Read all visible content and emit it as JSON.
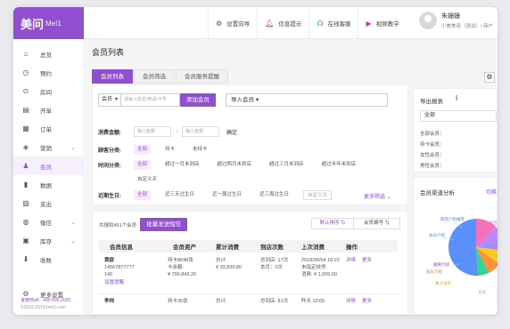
{
  "app": {
    "logo_text": "美问",
    "logo_sub": "MeI1",
    "brand_color": "#8f4fcf"
  },
  "top_nav": [
    {
      "label": "设置向导",
      "icon": "gear-icon",
      "color": "#555"
    },
    {
      "label": "信息提示",
      "icon": "bell-icon",
      "color": "#e0443a"
    },
    {
      "label": "在线客服",
      "icon": "headset-icon",
      "color": "#2ba7a0"
    },
    {
      "label": "视频教学",
      "icon": "play-icon",
      "color": "#c03ab7"
    }
  ],
  "user": {
    "name": "朱姗姗",
    "sub": "小美美容（测试）/ 商户"
  },
  "sidebar": {
    "items": [
      {
        "label": "总览",
        "icon": "home-icon",
        "glyph": "⌂"
      },
      {
        "label": "预约",
        "icon": "clock-icon",
        "glyph": "◷"
      },
      {
        "label": "房间",
        "icon": "bed-icon",
        "glyph": "⊙"
      },
      {
        "label": "开单",
        "icon": "receipt-icon",
        "glyph": "▤"
      },
      {
        "label": "订单",
        "icon": "order-icon",
        "glyph": "▦"
      },
      {
        "label": "营销",
        "icon": "basket-icon",
        "glyph": "◈",
        "chevron": true
      },
      {
        "label": "会员",
        "icon": "users-icon",
        "glyph": "♟",
        "active": true
      },
      {
        "label": "数据",
        "icon": "chart-icon",
        "glyph": "▮"
      },
      {
        "label": "支出",
        "icon": "expense-icon",
        "glyph": "▧"
      },
      {
        "label": "微信",
        "icon": "wechat-icon",
        "glyph": "◍",
        "chevron": true
      },
      {
        "label": "库存",
        "icon": "stock-icon",
        "glyph": "▣",
        "chevron": true
      },
      {
        "label": "收账",
        "icon": "download-icon",
        "glyph": "⬇"
      }
    ],
    "settings": {
      "label": "更多设置",
      "icon": "settings-icon",
      "glyph": "⚙"
    },
    "footer_service": "客服热线：400-006-2020",
    "footer_copyright": "©2015-2019,mei1.com"
  },
  "page": {
    "title": "会员列表",
    "tabs": [
      "会员列表",
      "会员筛选",
      "会员服务提醒"
    ]
  },
  "search": {
    "type_select": "会员",
    "placeholder": "请输入姓名/电话/卡号",
    "add_button": "添加会员",
    "import_select": "导入会员"
  },
  "filters": {
    "amount_label": "消费金额:",
    "amount_min_placeholder": "输入金额",
    "amount_max_placeholder": "输入金额",
    "amount_confirm": "确定",
    "customer_label": "顾客分类:",
    "customer_chips": [
      "全部",
      "持卡",
      "未持卡"
    ],
    "time_label": "时间分类:",
    "time_chips": [
      "全部",
      "超过一月未到店",
      "超过两月未到店",
      "超过三月未到店",
      "超过半年未到店"
    ],
    "time_extra": "自定义天",
    "birthday_label": "近期生日:",
    "birthday_chips": [
      "全部",
      "近三天过生日",
      "近一周过生日",
      "近三周过生日"
    ],
    "birthday_extra": "自定义天",
    "more": "更多筛选 ⌄"
  },
  "list": {
    "total_text": "共搜到451个会员",
    "sms_button": "批量发送短信",
    "sort_default": "默认排序 ⇅",
    "sort_code": "会员编号 ⇅",
    "columns": [
      "会员信息",
      "会员资产",
      "累计消费",
      "到店次数",
      "上次消费",
      "操作"
    ],
    "rows": [
      {
        "name": "黄欧",
        "phone": "14567877777",
        "extra": "140",
        "action_link": "设置提醒",
        "assets_1": "持卡8048张",
        "assets_2": "卡余额:",
        "assets_3": "¥ 796,843.20",
        "spend_label": "总计:",
        "spend_value": "¥ 33,839.80",
        "visits_1": "总到店: 17次",
        "visits_2": "本月：0次",
        "last_1": "2018/06/04 16:23",
        "last_2": "未指定技师",
        "last_3": "消费: ¥ 1,000.00",
        "op_detail": "详情",
        "op_more": "更多"
      },
      {
        "name": "李帅",
        "assets_1": "持卡35张",
        "spend_label": "总计:",
        "visits_1": "总到店: 81次",
        "last_1": "昨天 10:05",
        "op_detail": "详情",
        "op_more": "更多"
      }
    ]
  },
  "right": {
    "export_title": "导出报表",
    "export_select": "全部",
    "stats": [
      "全部会员：",
      "持卡会员：",
      "女性会员：",
      "男性会员："
    ],
    "channel_title": "会员渠道分析",
    "channel_link": "切换",
    "pie_labels": [
      {
        "text": "朋友户给推荐",
        "color": "#5b7fe0"
      },
      {
        "text": "会员介绍",
        "color": "#5b7fe0"
      },
      {
        "text": "美团",
        "color": "#e06bd0"
      },
      {
        "text": "雅阁介绍",
        "color": "#8f4fcf"
      },
      {
        "text": "股东介绍",
        "color": "#e07b3a"
      },
      {
        "text": "路过进店",
        "color": "#e0a93a"
      },
      {
        "text": "其他",
        "color": "#c0a0e0"
      }
    ],
    "pie_colors": [
      "#5b8ff9",
      "#f472b6",
      "#a78bfa",
      "#facc15",
      "#fb923c",
      "#34d399",
      "#60a5fa",
      "#c084fc"
    ]
  }
}
